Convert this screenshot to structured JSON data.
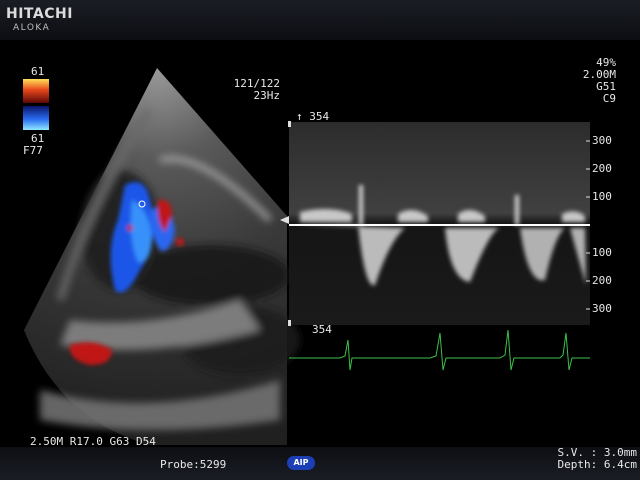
{
  "branding": {
    "brand_line1": "HITACHI",
    "brand_line2": "ALOKA"
  },
  "color_scale": {
    "top_value": "61",
    "bottom_value": "61",
    "filter": "F77"
  },
  "frame_info": {
    "frame_counter": "121/122",
    "frame_rate": "23Hz"
  },
  "right_panel": {
    "gain_percent": "49%",
    "frequency": "2.00M",
    "gain": "G51",
    "preset": "C9"
  },
  "doppler": {
    "top_marker": "↑ 354",
    "bottom_marker": "354",
    "scale_labels": [
      "300",
      "200",
      "100",
      "100",
      "200",
      "300"
    ],
    "scale_values": [
      300,
      200,
      100,
      -100,
      -200,
      -300
    ]
  },
  "bmode_params": "2.50M R17.0 G63 D54",
  "probe": "Probe:5299",
  "aip_badge": "AIP",
  "sample_volume": "S.V. : 3.0mm",
  "depth": "Depth: 6.4cm",
  "colors": {
    "ecg": "#3bc14a",
    "flow_blue": "#1e56e8",
    "flow_red": "#c01818"
  }
}
